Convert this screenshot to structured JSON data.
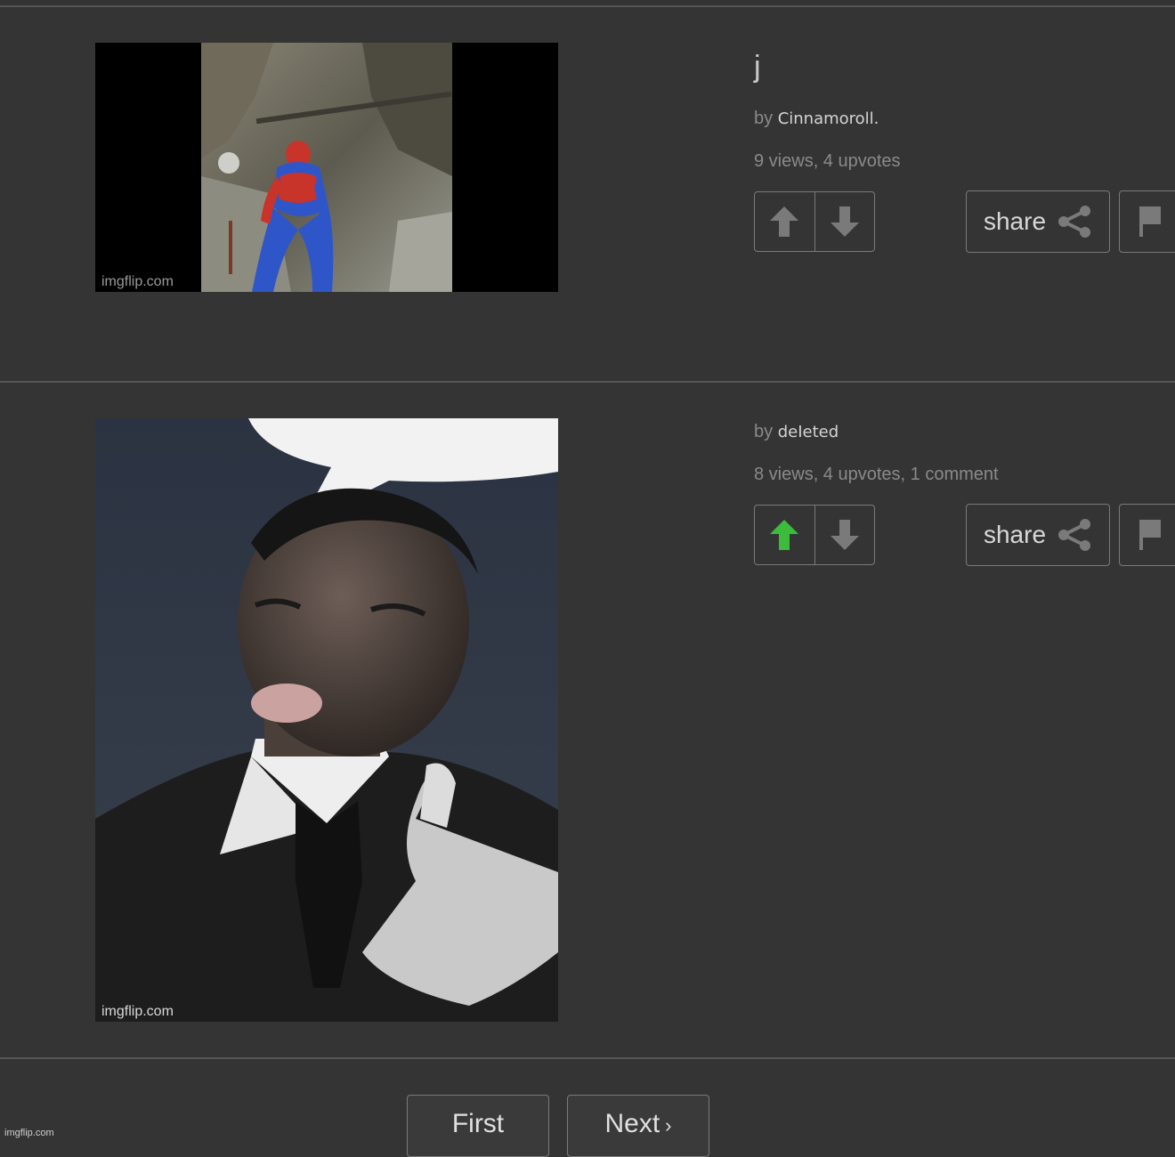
{
  "posts": [
    {
      "title": "j",
      "by_label": "by",
      "author": "Cinnamoroll.",
      "stats": "9 views, 4 upvotes",
      "image_alt": "Spider-Man costume dancing",
      "image_watermark": "imgflip.com",
      "upvoted": false,
      "share_label": "share"
    },
    {
      "title": "",
      "by_label": "by",
      "author": "deIeted",
      "stats": "8 views, 4 upvotes, 1 comment",
      "image_alt": "Man in suit thinking, with speech bubble",
      "image_watermark": "imgflip.com",
      "upvoted": true,
      "share_label": "share"
    }
  ],
  "pagination": {
    "first_label": "First",
    "next_label": "Next",
    "next_chevron": "›"
  },
  "site_watermark": "imgflip.com",
  "colors": {
    "background": "#343434",
    "upvote_active": "#3dbb3d",
    "icon_inactive": "#7a7a7a"
  }
}
